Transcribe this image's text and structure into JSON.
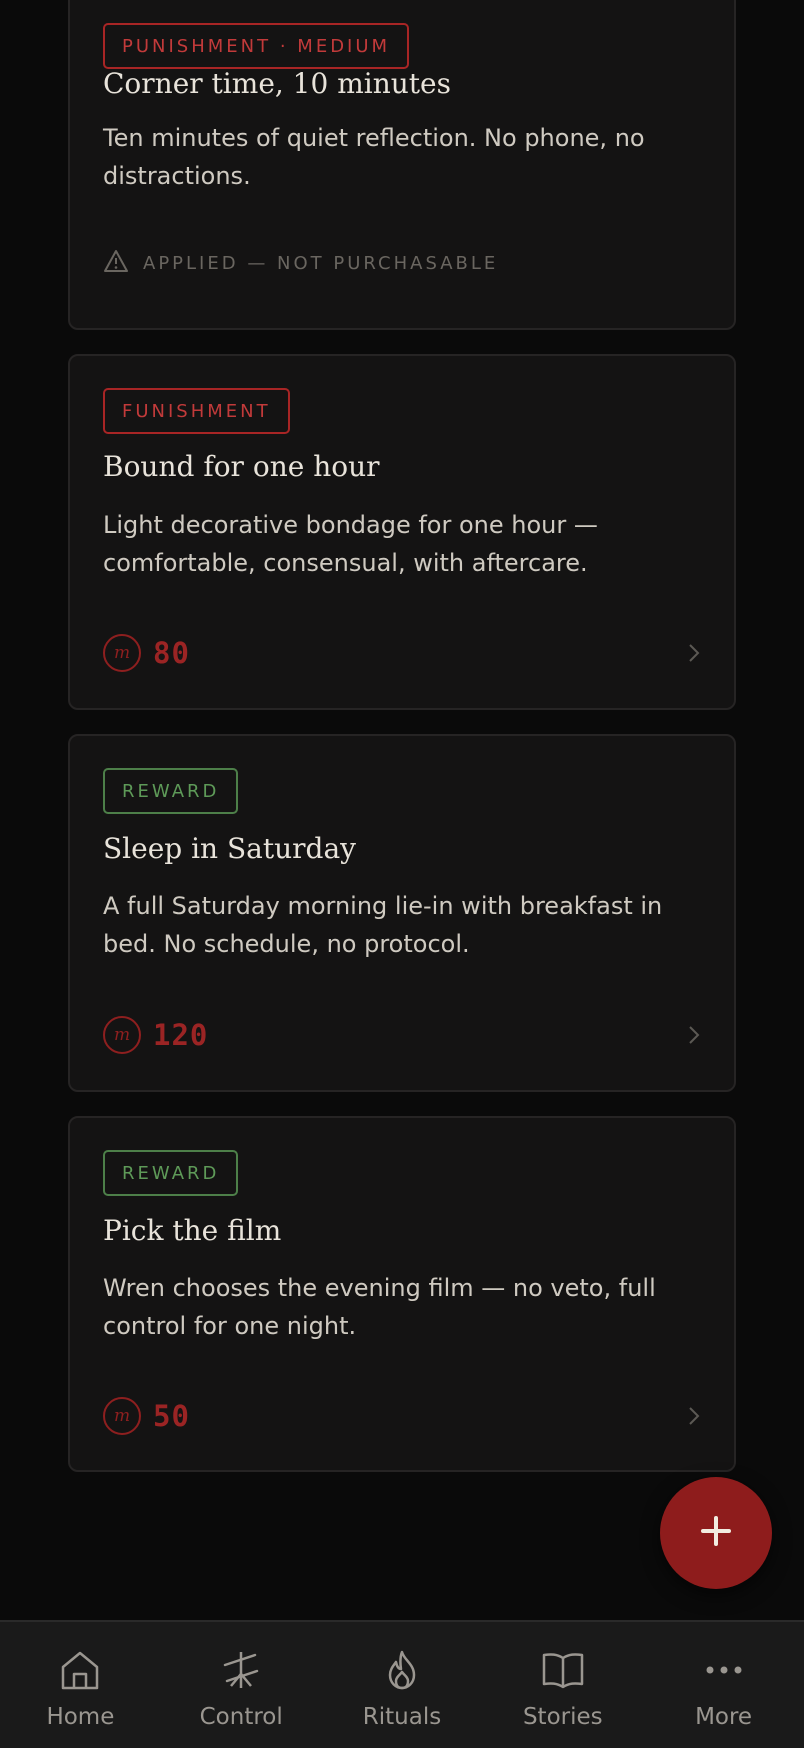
{
  "colors": {
    "background": "#0a0a0a",
    "card": "#141313",
    "punishment": "#c23a3a",
    "reward": "#5e9a58",
    "accent": "#8e1c1c"
  },
  "cards": [
    {
      "tag": "PUNISHMENT · MEDIUM",
      "tag_type": "punishment",
      "title": "Corner time, 10 minutes",
      "description": "Ten minutes of quiet reflection. No phone, no distractions.",
      "status_icon": "warning-icon",
      "status": "APPLIED — NOT PURCHASABLE"
    },
    {
      "tag": "FUNISHMENT",
      "tag_type": "punishment",
      "title": "Bound for one hour",
      "description": "Light decorative bondage for one hour — comfortable, consensual, with aftercare.",
      "coin_symbol": "m",
      "price": "80"
    },
    {
      "tag": "REWARD",
      "tag_type": "reward",
      "title": "Sleep in Saturday",
      "description": "A full Saturday morning lie-in with breakfast in bed. No schedule, no protocol.",
      "coin_symbol": "m",
      "price": "120"
    },
    {
      "tag": "REWARD",
      "tag_type": "reward",
      "title": "Pick the film",
      "description": "Wren chooses the evening film — no veto, full control for one night.",
      "coin_symbol": "m",
      "price": "50"
    }
  ],
  "fab": {
    "icon": "plus-icon"
  },
  "nav": [
    {
      "label": "Home",
      "icon": "home-icon"
    },
    {
      "label": "Control",
      "icon": "control-icon"
    },
    {
      "label": "Rituals",
      "icon": "flame-icon"
    },
    {
      "label": "Stories",
      "icon": "book-icon"
    },
    {
      "label": "More",
      "icon": "more-icon"
    }
  ]
}
